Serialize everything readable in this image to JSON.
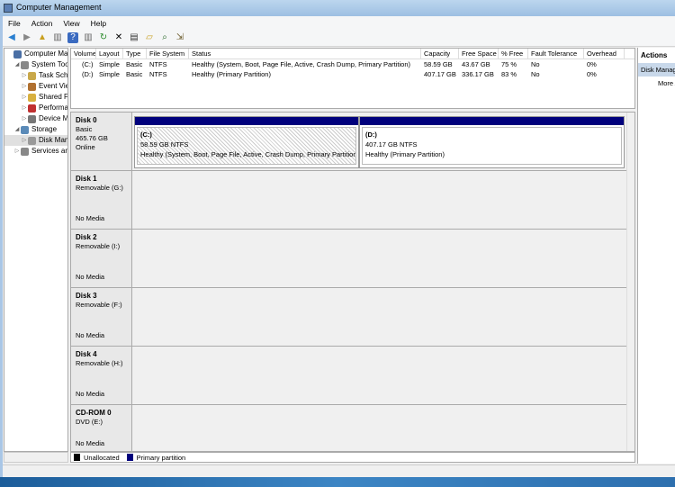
{
  "window": {
    "title": "Computer Management"
  },
  "menu": [
    "File",
    "Action",
    "View",
    "Help"
  ],
  "toolbar": [
    "back-icon",
    "forward-icon",
    "up-icon",
    "show-hide-tree-icon",
    "help-icon",
    "show-hide-action-icon",
    "refresh-icon",
    "delete-icon",
    "properties-icon",
    "open-icon",
    "search-icon",
    "export-icon"
  ],
  "tree": [
    {
      "label": "Computer Management (Local)",
      "level": 0,
      "color": "#4a6fa5"
    },
    {
      "label": "System Tools",
      "level": 1,
      "expanded": true,
      "color": "#888"
    },
    {
      "label": "Task Scheduler",
      "level": 2,
      "color": "#c9a84a"
    },
    {
      "label": "Event Viewer",
      "level": 2,
      "color": "#b07030"
    },
    {
      "label": "Shared Folders",
      "level": 2,
      "color": "#d8b040"
    },
    {
      "label": "Performance",
      "level": 2,
      "color": "#c03030"
    },
    {
      "label": "Device Manager",
      "level": 2,
      "color": "#777"
    },
    {
      "label": "Storage",
      "level": 1,
      "expanded": true,
      "color": "#5a8ab8"
    },
    {
      "label": "Disk Management",
      "level": 2,
      "color": "#999",
      "selected": true
    },
    {
      "label": "Services and Applications",
      "level": 1,
      "color": "#888"
    }
  ],
  "volumes": {
    "columns": [
      "Volume",
      "Layout",
      "Type",
      "File System",
      "Status",
      "Capacity",
      "Free Space",
      "% Free",
      "Fault Tolerance",
      "Overhead"
    ],
    "rows": [
      [
        "(C:)",
        "Simple",
        "Basic",
        "NTFS",
        "Healthy (System, Boot, Page File, Active, Crash Dump, Primary Partition)",
        "58.59 GB",
        "43.67 GB",
        "75 %",
        "No",
        "0%"
      ],
      [
        "(D:)",
        "Simple",
        "Basic",
        "NTFS",
        "Healthy (Primary Partition)",
        "407.17 GB",
        "336.17 GB",
        "83 %",
        "No",
        "0%"
      ]
    ]
  },
  "disks": [
    {
      "name": "Disk 0",
      "line1": "Basic",
      "line2": "465.76 GB",
      "line3": "Online",
      "partitions": [
        {
          "label": "(C:)",
          "size": "58.59 GB NTFS",
          "status": "Healthy (System, Boot, Page File, Active, Crash Dump, Primary Partition)",
          "selected": true
        },
        {
          "label": "(D:)",
          "size": "407.17 GB NTFS",
          "status": "Healthy (Primary Partition)"
        }
      ]
    },
    {
      "name": "Disk 1",
      "line1": "Removable (G:)",
      "line3": "No Media"
    },
    {
      "name": "Disk 2",
      "line1": "Removable (I:)",
      "line3": "No Media"
    },
    {
      "name": "Disk 3",
      "line1": "Removable (F:)",
      "line3": "No Media"
    },
    {
      "name": "Disk 4",
      "line1": "Removable (H:)",
      "line3": "No Media"
    },
    {
      "name": "CD-ROM 0",
      "line1": "DVD (E:)",
      "line3": "No Media"
    }
  ],
  "legend": [
    {
      "label": "Unallocated",
      "color": "#000000"
    },
    {
      "label": "Primary partition",
      "color": "#00007c"
    }
  ],
  "actions": {
    "title": "Actions",
    "section": "Disk Management",
    "more": "More Actions"
  }
}
